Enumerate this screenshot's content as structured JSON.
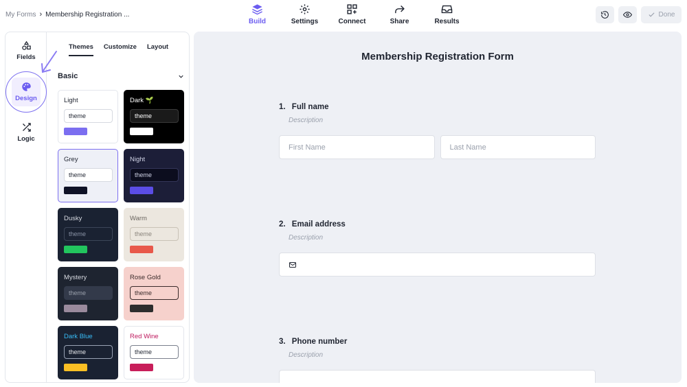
{
  "breadcrumb": {
    "root": "My Forms",
    "separator": "›",
    "current": "Membership Registration ..."
  },
  "nav_tabs": [
    {
      "label": "Build",
      "icon": "layers-icon",
      "active": true
    },
    {
      "label": "Settings",
      "icon": "gear-icon",
      "active": false
    },
    {
      "label": "Connect",
      "icon": "connect-grid-icon",
      "active": false
    },
    {
      "label": "Share",
      "icon": "share-arrow-icon",
      "active": false
    },
    {
      "label": "Results",
      "icon": "inbox-icon",
      "active": false
    }
  ],
  "toolbar": {
    "done_label": "Done"
  },
  "rail": [
    {
      "label": "Fields",
      "icon": "shapes-icon"
    },
    {
      "label": "Design",
      "icon": "palette-icon",
      "active": true
    },
    {
      "label": "Logic",
      "icon": "shuffle-icon"
    }
  ],
  "subtabs": [
    {
      "label": "Themes",
      "active": true
    },
    {
      "label": "Customize",
      "active": false
    },
    {
      "label": "Layout",
      "active": false
    }
  ],
  "section": {
    "title": "Basic"
  },
  "themes": [
    {
      "name": "Light",
      "input": "theme",
      "bg": "#ffffff",
      "name_color": "#1f2430",
      "input_bg": "#ffffff",
      "input_border": "#d6d9e0",
      "input_text": "#1f2430",
      "button": "#7b6ef0",
      "border": "#e3e6ec"
    },
    {
      "name": "Dark 🌱",
      "input": "theme",
      "bg": "#000000",
      "name_color": "#ffffff",
      "input_bg": "#1a1a1a",
      "input_border": "#3a3a3a",
      "input_text": "#ffffff",
      "button": "#ffffff",
      "border": "#000000"
    },
    {
      "name": "Grey",
      "input": "theme",
      "bg": "#eef0f7",
      "name_color": "#1f2430",
      "input_bg": "#ffffff",
      "input_border": "#d6d9e0",
      "input_text": "#1f2430",
      "button": "#0f1226",
      "border": "#7b6ef0"
    },
    {
      "name": "Night",
      "input": "theme",
      "bg": "#1c1e38",
      "name_color": "#d0d3e6",
      "input_bg": "#0c0d1e",
      "input_border": "#34365a",
      "input_text": "#d0d3e6",
      "button": "#5b4de6",
      "border": "#1c1e38"
    },
    {
      "name": "Dusky",
      "input": "theme",
      "bg": "#1a2232",
      "name_color": "#d8dbe2",
      "input_bg": "#1a2232",
      "input_border": "#3c4658",
      "input_text": "#8a93a6",
      "button": "#22c55e",
      "border": "#1a2232"
    },
    {
      "name": "Warm",
      "input": "theme",
      "bg": "#ece7df",
      "name_color": "#6b6660",
      "input_bg": "#ece7df",
      "input_border": "#c9c2b6",
      "input_text": "#8a847c",
      "button": "#e8584a",
      "border": "#ece7df"
    },
    {
      "name": "Mystery",
      "input": "theme",
      "bg": "#1e2430",
      "name_color": "#d8dbe2",
      "input_bg": "#333a4a",
      "input_border": "#333a4a",
      "input_text": "#9aa0ac",
      "button": "#9a8a9c",
      "border": "#1e2430"
    },
    {
      "name": "Rose Gold",
      "input": "theme",
      "bg": "#f6d1cc",
      "name_color": "#3a2a2a",
      "input_bg": "#f6d1cc",
      "input_border": "#3a2a2a",
      "input_text": "#3a2a2a",
      "button": "#2d2d2d",
      "border": "#f6d1cc"
    },
    {
      "name": "Dark Blue",
      "input": "theme",
      "bg": "#1a2232",
      "name_color": "#38bdf8",
      "input_bg": "#1a2232",
      "input_border": "#9aa3b5",
      "input_text": "#e5e7eb",
      "button": "#fbbf24",
      "border": "#1a2232"
    },
    {
      "name": "Red Wine",
      "input": "theme",
      "bg": "#ffffff",
      "name_color": "#be185d",
      "input_bg": "#ffffff",
      "input_border": "#7a7f8c",
      "input_text": "#1f2430",
      "button": "#c81e5a",
      "border": "#e3e6ec"
    }
  ],
  "form": {
    "title": "Membership Registration Form",
    "questions": [
      {
        "number": "1.",
        "title": "Full name",
        "description": "Description",
        "fields": [
          "First Name",
          "Last Name"
        ]
      },
      {
        "number": "2.",
        "title": "Email address",
        "description": "Description",
        "fields": []
      },
      {
        "number": "3.",
        "title": "Phone number",
        "description": "Description",
        "fields": []
      }
    ]
  },
  "colors": {
    "accent": "#6b5cf0",
    "preview_bg": "#eef0f5"
  }
}
